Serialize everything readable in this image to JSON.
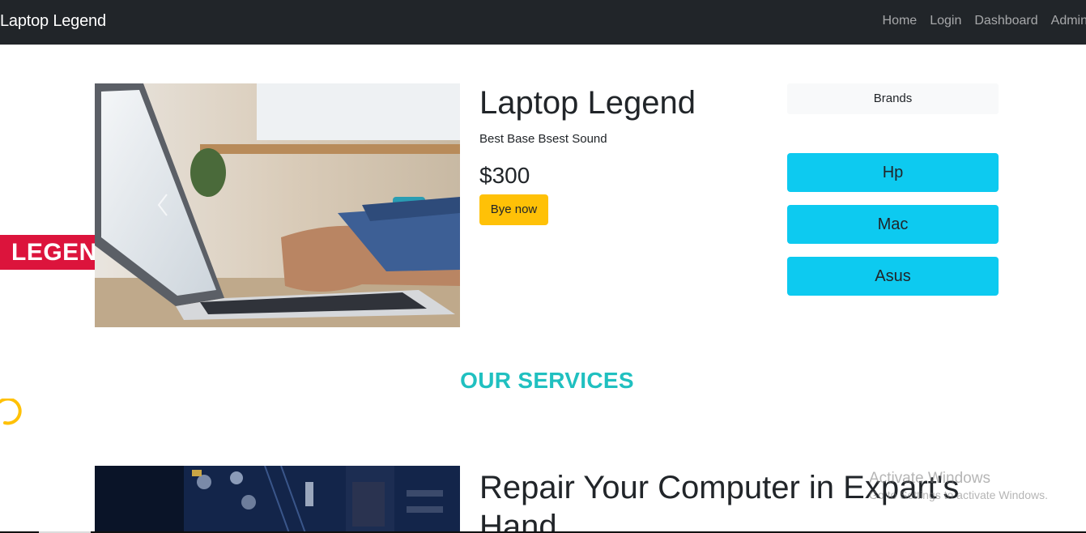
{
  "navbar": {
    "brand": "Laptop Legend",
    "links": [
      "Home",
      "Login",
      "Dashboard",
      "Admin"
    ]
  },
  "side_tag": {
    "text": "LEGEN"
  },
  "product": {
    "title": "Laptop Legend",
    "subtitle": "Best Base Bsest Sound",
    "price": "$300",
    "buy_label": "Bye now"
  },
  "brands": {
    "header": "Brands",
    "items": [
      "Hp",
      "Mac",
      "Asus"
    ]
  },
  "services": {
    "heading": "OUR SERVICES",
    "item_title": "Repair Your Computer in Expart's Hand"
  },
  "watermark": {
    "line1": "Activate Windows",
    "line2": "Go to Settings to activate Windows."
  },
  "colors": {
    "navbar": "#212529",
    "accent_red": "#dc143c",
    "buy_button": "#ffc107",
    "brand_button": "#0dcaf0",
    "services_heading": "#20c0c0"
  }
}
